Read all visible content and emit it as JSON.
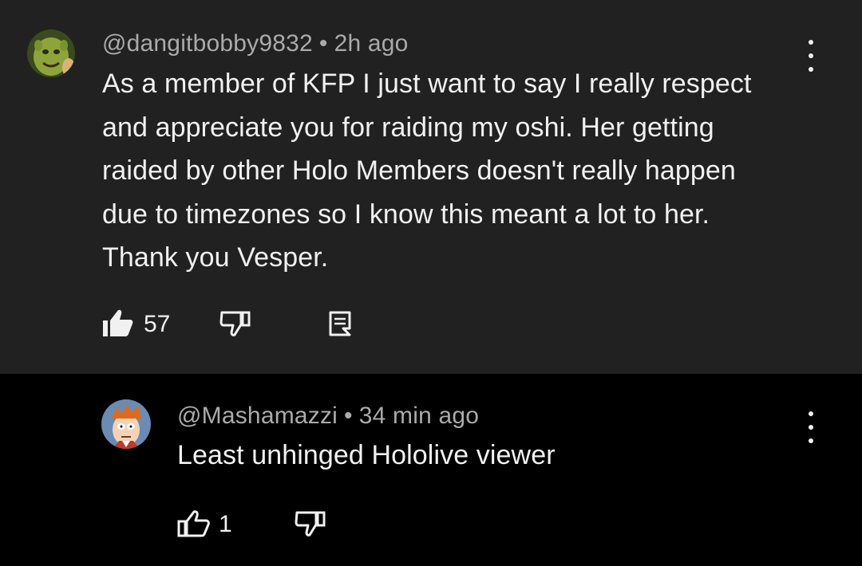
{
  "comment": {
    "author": "@dangitbobby9832",
    "separator": "•",
    "time": "2h ago",
    "lines": [
      "As a member of KFP I just want to say I really respect",
      "and appreciate you for raiding my oshi. Her getting",
      "raided by other Holo Members doesn't really happen",
      "due to timezones so I know this meant a lot to her.",
      "Thank you Vesper."
    ],
    "like_count": "57",
    "avatar_icon": "shrek-avatar-icon",
    "like_icon": "thumbs-up-filled-icon",
    "dislike_icon": "thumbs-down-outline-icon",
    "reply_icon": "comment-reply-icon",
    "menu_icon": "more-vert-icon"
  },
  "reply": {
    "author": "@Mashamazzi",
    "separator": "•",
    "time": "34 min ago",
    "text": "Least unhinged Hololive viewer",
    "like_count": "1",
    "avatar_icon": "fry-avatar-icon",
    "like_icon": "thumbs-up-outline-icon",
    "dislike_icon": "thumbs-down-outline-icon",
    "menu_icon": "more-vert-icon"
  },
  "colors": {
    "main_bg": "#212121",
    "reply_bg": "#000000",
    "text": "#f1f1f1",
    "meta": "#aaaaaa"
  }
}
